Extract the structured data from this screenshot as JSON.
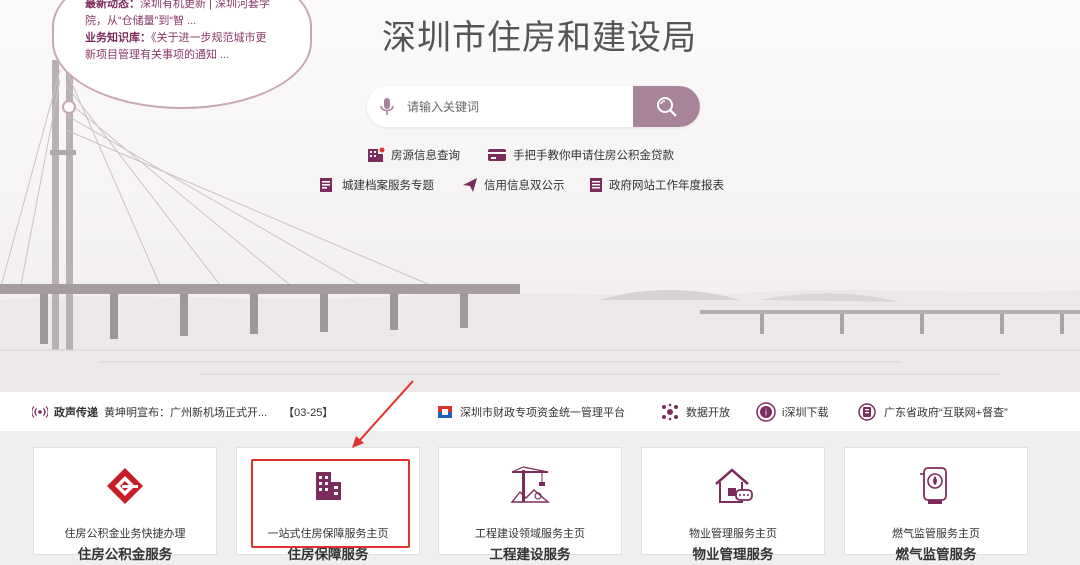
{
  "bubble": {
    "latest_label": "最新动态：",
    "latest_text": "深圳有机更新 | 深圳河套学院，从“仓储量”到“智 ...",
    "kb_label": "业务知识库：",
    "kb_text": "《关于进一步规范城市更新项目管理有关事项的通知 ..."
  },
  "site_title": "深圳市住房和建设局",
  "search": {
    "placeholder": "请输入关键词"
  },
  "quick_links": [
    "房源信息查询",
    "手把手教你申请住房公积金贷款",
    "城建档案服务专题",
    "信用信息双公示",
    "政府网站工作年度报表"
  ],
  "newsbar": {
    "label": "政声传递",
    "headline": "黄坤明宣布：广州新机场正式开...",
    "date": "【03-25】",
    "links": [
      "深圳市财政专项资金统一管理平台",
      "数据开放",
      "i深圳下载",
      "广东省政府“互联网+督查”"
    ]
  },
  "services": [
    {
      "sub": "住房公积金业务快捷办理",
      "main": "住房公积金服务",
      "icon": "housing-fund-icon"
    },
    {
      "sub": "一站式住房保障服务主页",
      "main": "住房保障服务",
      "icon": "housing-security-icon"
    },
    {
      "sub": "工程建设领域服务主页",
      "main": "工程建设服务",
      "icon": "construction-crane-icon"
    },
    {
      "sub": "物业管理服务主页",
      "main": "物业管理服务",
      "icon": "property-management-icon"
    },
    {
      "sub": "燃气监管服务主页",
      "main": "燃气监管服务",
      "icon": "gas-supervision-icon"
    }
  ],
  "colors": {
    "accent": "#a8849a",
    "brand_purple": "#7b2b5c",
    "annotation_red": "#e0322c"
  }
}
